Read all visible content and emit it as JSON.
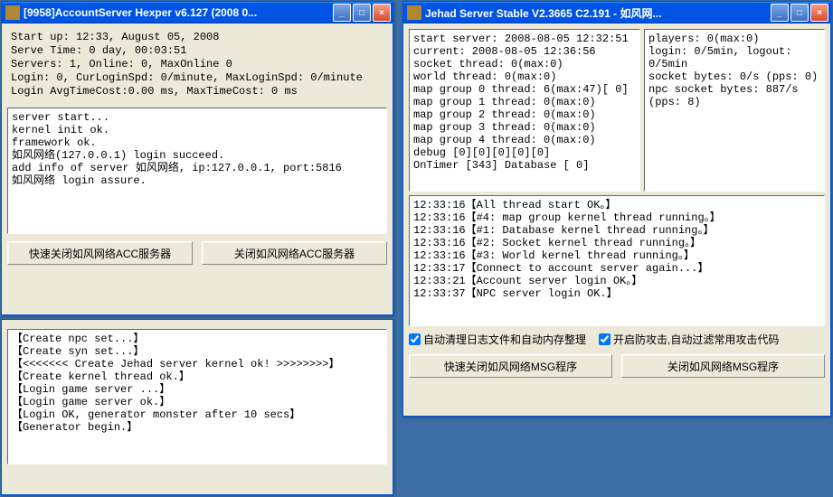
{
  "win1": {
    "title": "[9958]AccountServer Hexper v6.127 (2008 0...",
    "info": {
      "l1": "Start up: 12:33, August 05, 2008",
      "l2": "Serve Time: 0 day, 00:03:51",
      "l3": "Servers: 1, Online:   0, MaxOnline   0",
      "l4": "Login:      0, CurLoginSpd:   0/minute, MaxLoginSpd:   0/minute",
      "l5": "Login AvgTimeCost:0.00 ms, MaxTimeCost:   0 ms"
    },
    "log": {
      "l1": "server start...",
      "l2": "kernel init ok.",
      "l3": "framework ok.",
      "l4": "如风网络(127.0.0.1) login succeed.",
      "l5": "add info of server 如风网络, ip:127.0.0.1, port:5816",
      "l6": "如风网络 login assure."
    },
    "btn1": "快速关闭如风网络ACC服务器",
    "btn2": "关闭如风网络ACC服务器"
  },
  "win2": {
    "title": "Jehad Server Stable V2.3665 C2.191 - 如风网...",
    "left": {
      "l1": "start server: 2008-08-05 12:32:51",
      "l2": "current: 2008-08-05 12:36:56",
      "l3": " ",
      "l4": "socket thread:   0(max:0)",
      "l5": "world thread:    0(max:0)",
      "l6": "map group 0 thread:   6(max:47)[  0]",
      "l7": "map group 1 thread:   0(max:0)",
      "l8": "map group 2 thread:   0(max:0)",
      "l9": "map group 3 thread:   0(max:0)",
      "l10": "map group 4 thread:   0(max:0)",
      "l11": "debug [0][0][0][0][0]",
      "l12": "OnTimer [343] Database [  0]"
    },
    "right": {
      "l1": "players:   0(max:0)",
      "l2": "login: 0/5min, logout: 0/5min",
      "l3": " ",
      "l4": "socket bytes:   0/s (pps: 0)",
      "l5": "npc socket bytes: 887/s (pps: 8)"
    },
    "log": {
      "l1": "12:33:16【All thread start OK。】",
      "l2": "12:33:16【#4: map group kernel thread running。】",
      "l3": "12:33:16【#1: Database kernel thread running。】",
      "l4": "12:33:16【#2: Socket kernel thread running。】",
      "l5": "12:33:16【#3: World kernel thread running。】",
      "l6": "12:33:17【Connect to account server again...】",
      "l7": "12:33:21【Account server login OK。】",
      "l8": "12:33:37【NPC server login OK.】"
    },
    "chk1": "自动清理日志文件和自动内存整理",
    "chk2": "开启防攻击,自动过滤常用攻击代码",
    "btn1": "快速关闭如风网络MSG程序",
    "btn2": "关闭如风网络MSG程序"
  },
  "win3": {
    "log": {
      "l1": "【Create npc set...】",
      "l2": "【Create syn set...】",
      "l3": "【<<<<<<< Create Jehad server kernel ok! >>>>>>>>】",
      "l4": "【Create kernel thread ok.】",
      "l5": "【Login game server ...】",
      "l6": "【Login game server ok.】",
      "l7": "【Login OK, generator monster after 10 secs】",
      "l8": "【Generator begin.】"
    }
  }
}
